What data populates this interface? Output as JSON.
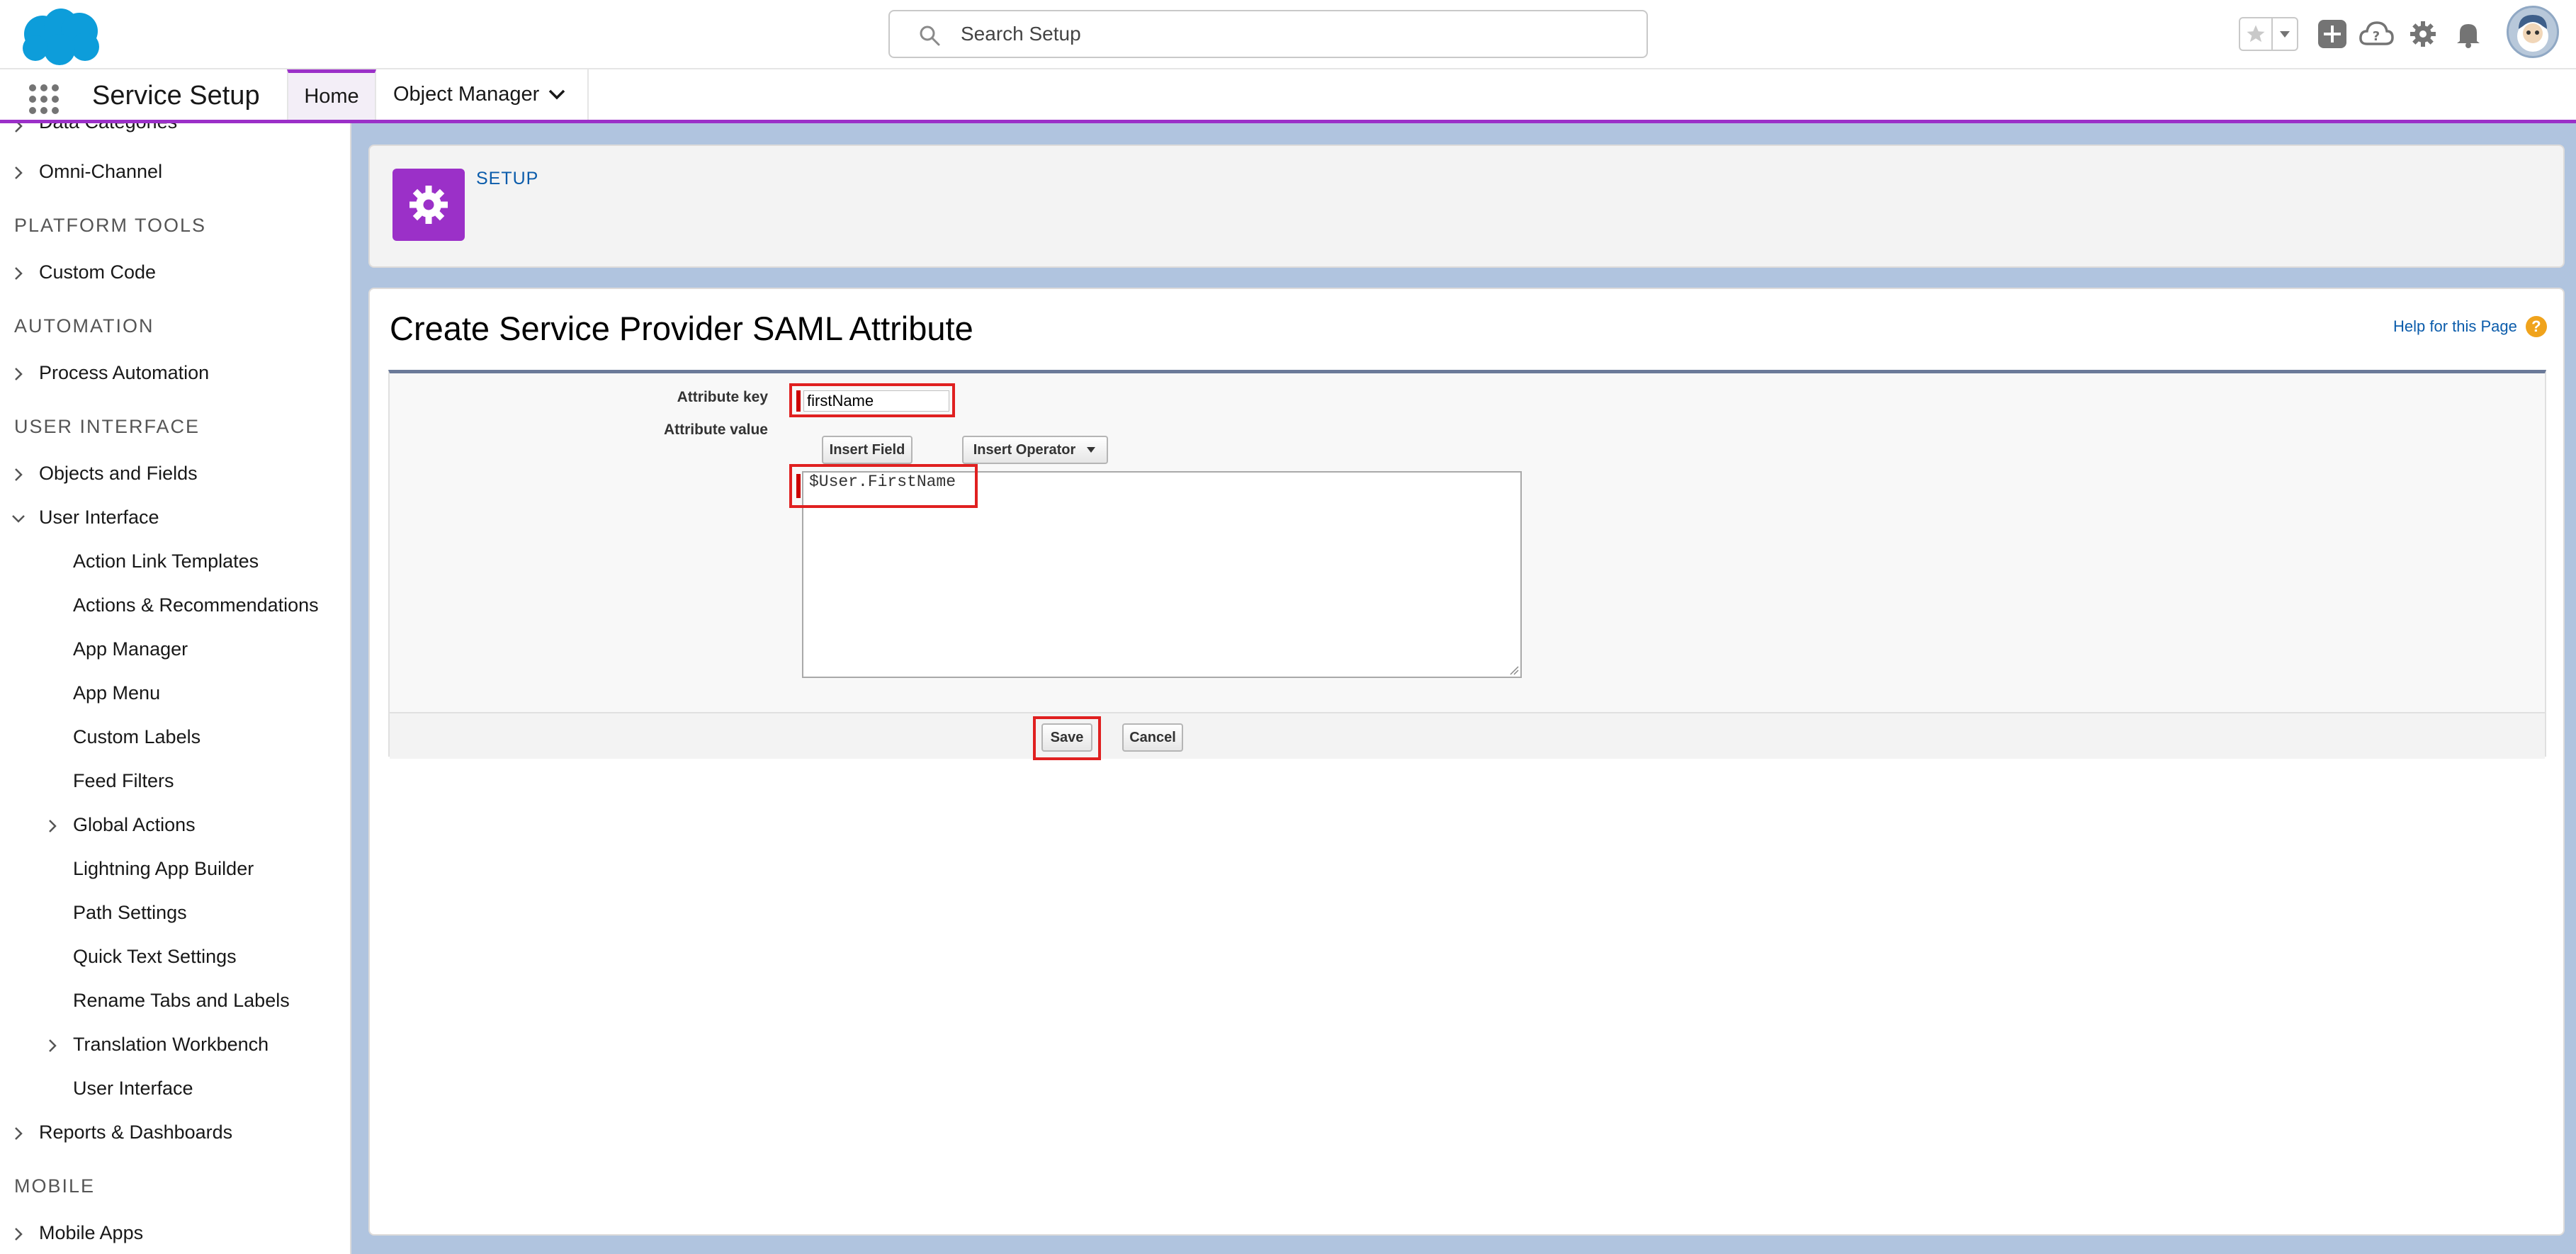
{
  "header": {
    "search_placeholder": "Search Setup"
  },
  "context_bar": {
    "app_name": "Service Setup",
    "tabs": [
      {
        "label": "Home"
      },
      {
        "label": "Object Manager"
      }
    ]
  },
  "sidebar": {
    "items": [
      {
        "label": "Data Categories"
      },
      {
        "label": "Omni-Channel"
      },
      {
        "section": "PLATFORM TOOLS"
      },
      {
        "label": "Custom Code"
      },
      {
        "section": "AUTOMATION"
      },
      {
        "label": "Process Automation"
      },
      {
        "section": "USER INTERFACE"
      },
      {
        "label": "Objects and Fields"
      },
      {
        "label": "User Interface"
      },
      {
        "label": "Action Link Templates"
      },
      {
        "label": "Actions & Recommendations"
      },
      {
        "label": "App Manager"
      },
      {
        "label": "App Menu"
      },
      {
        "label": "Custom Labels"
      },
      {
        "label": "Feed Filters"
      },
      {
        "label": "Global Actions"
      },
      {
        "label": "Lightning App Builder"
      },
      {
        "label": "Path Settings"
      },
      {
        "label": "Quick Text Settings"
      },
      {
        "label": "Rename Tabs and Labels"
      },
      {
        "label": "Translation Workbench"
      },
      {
        "label": "User Interface"
      },
      {
        "label": "Reports & Dashboards"
      },
      {
        "section": "MOBILE"
      },
      {
        "label": "Mobile Apps"
      }
    ]
  },
  "setup_header": {
    "label": "SETUP"
  },
  "page": {
    "title": "Create Service Provider SAML Attribute",
    "help_link": "Help for this Page"
  },
  "form": {
    "attribute_key_label": "Attribute key",
    "attribute_key_value": "firstName",
    "attribute_value_label": "Attribute value",
    "insert_field_label": "Insert Field",
    "insert_operator_label": "Insert Operator",
    "attribute_value_text": "$User.FirstName",
    "save_label": "Save",
    "cancel_label": "Cancel"
  },
  "colors": {
    "brand_purple": "#9b30c8",
    "highlight_red": "#e02020",
    "link_blue": "#0b5cab"
  }
}
